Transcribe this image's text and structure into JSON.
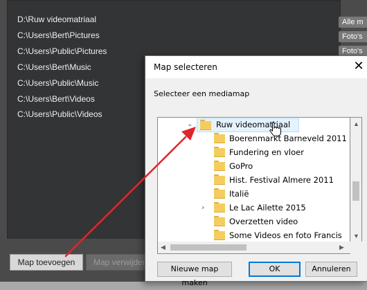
{
  "app": {
    "paths": [
      "D:\\Ruw videomatriaal",
      "C:\\Users\\Bert\\Pictures",
      "C:\\Users\\Public\\Pictures",
      "C:\\Users\\Bert\\Music",
      "C:\\Users\\Public\\Music",
      "C:\\Users\\Bert\\Videos",
      "C:\\Users\\Public\\Videos"
    ],
    "tags": [
      "Alle m",
      "Foto's",
      "Foto's"
    ],
    "add_label": "Map toevoegen",
    "remove_label": "Map verwijder"
  },
  "dialog": {
    "title": "Map selecteren",
    "close_glyph": "✕",
    "prompt": "Selecteer een mediamap",
    "root_folder": "Ruw videomatriaal",
    "subfolders": [
      "Boerenmarkt Barneveld 2011",
      "Fundering en vloer",
      "GoPro",
      "Hist. Festival Almere 2011",
      "Italië",
      "Le Lac Ailette 2015",
      "Overzetten video",
      "Some Videos en foto Francis"
    ],
    "new_folder_label": "Nieuwe map maken",
    "ok_label": "OK",
    "cancel_label": "Annuleren"
  },
  "colors": {
    "arrow": "#e0262b",
    "folder": "#f5cd5e",
    "selection": "#e5f3ff"
  }
}
